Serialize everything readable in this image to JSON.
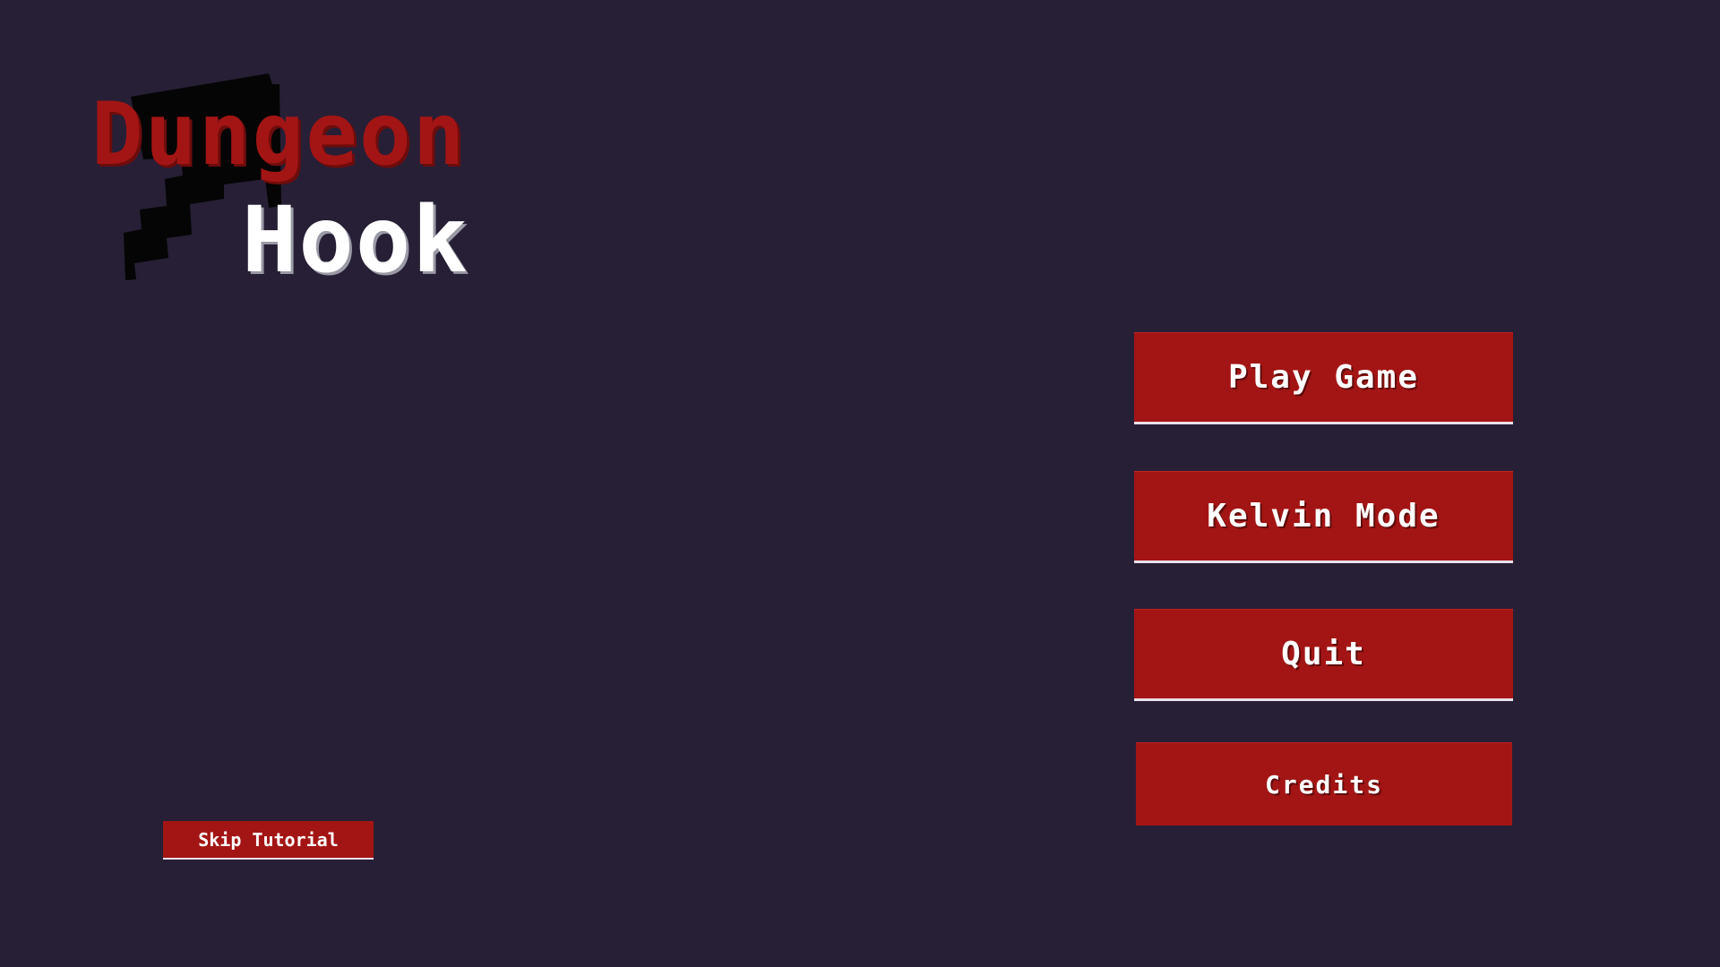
{
  "logo": {
    "line1": "Dungeon",
    "line2": "Hook",
    "icon": "hook-icon"
  },
  "menu": {
    "play_label": "Play Game",
    "kelvin_label": "Kelvin Mode",
    "quit_label": "Quit",
    "credits_label": "Credits"
  },
  "tutorial": {
    "skip_label": "Skip Tutorial"
  },
  "colors": {
    "background": "#271f36",
    "button": "#a31514",
    "logo_red": "#a31514",
    "logo_white": "#ffffff"
  }
}
